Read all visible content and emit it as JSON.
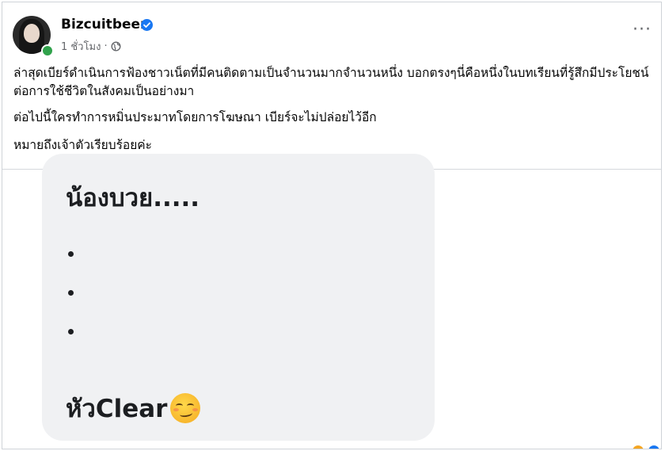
{
  "post": {
    "author_name": "Bizcuitbeer",
    "timestamp": "1 ชั่วโมง",
    "separator": "·",
    "icons": {
      "verified": "verified-badge-icon",
      "audience": "globe-icon",
      "more": "more-options-icon"
    },
    "more_label": "···",
    "caption": [
      "ล่าสุดเบียร์ดำเนินการฟ้องชาวเน็ตที่มีคนติดตามเป็นจำนวนมากจำนวนหนึ่ง บอกตรงๆนี่คือหนึ่งในบทเรียนที่รู้สึกมีประโยชน์ต่อการใช้ชีวิตในสังคมเป็นอย่างมา",
      "ต่อไปนี้ใครทำการหมิ่นประมาทโดยการโฆษณา เบียร์จะไม่ปล่อยไว้อีก",
      "หมายถึงเจ้าตัวเรียบร้อยค่ะ"
    ]
  },
  "image": {
    "heading": "น้องบวย.....",
    "bullets": [
      "•",
      "•",
      "•"
    ],
    "footer_text": "หัวClear",
    "footer_emoji": "smirking-face-emoji"
  },
  "colors": {
    "verified": "#1877f2",
    "online": "#31a24c",
    "meta_text": "#65676b",
    "bubble_bg": "#f0f1f3"
  }
}
